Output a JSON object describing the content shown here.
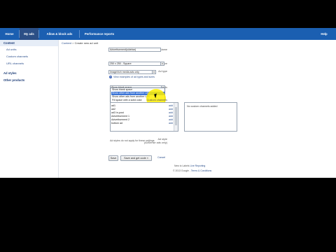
{
  "nav": {
    "items": [
      {
        "label": "Home",
        "active": false
      },
      {
        "label": "My ads",
        "active": true
      },
      {
        "label": "Allow & block ads",
        "active": false
      },
      {
        "label": "Performance reports",
        "active": false
      }
    ],
    "help_label": "Help"
  },
  "sidebar": {
    "content_label": "Content",
    "items": [
      "Ad units",
      "Custom channels",
      "URL channels"
    ],
    "ad_styles_label": "Ad styles",
    "other_products_label": "Other products"
  },
  "breadcrumb": {
    "parent": "Content",
    "separator": ">",
    "current": "Create new ad unit"
  },
  "form": {
    "name_label": "Name",
    "name_value": "Advertisement(sidebar)",
    "ad_size_label": "Ad size",
    "ad_size_value": "250 x 250 - Square",
    "ad_type_label": "Ad type",
    "ad_type_value": "Image/rich media ads only",
    "examples_link": "View examples of ad types and sizes",
    "backup_label": "Backup ads",
    "backup_options": [
      "Show blank space",
      "Show other ads from another URL",
      "Show other ads from another URL",
      "Fill space with a solid color"
    ],
    "custom_channels_label": "Custom channels",
    "channels": [
      {
        "name": "ad1",
        "add": "add"
      },
      {
        "name": "ad2",
        "add": "add"
      },
      {
        "name": "ad3 in-post",
        "add": "add"
      },
      {
        "name": "Advertisement 1",
        "add": "add"
      },
      {
        "name": "Advertisement 2",
        "add": "add"
      },
      {
        "name": "bottom ad",
        "add": "add"
      }
    ],
    "no_channels_text": "No custom channels added",
    "ad_style_label": "Ad style",
    "ad_style_sublabel": "(AdSense ads only)",
    "ad_style_note": "Ad styles do not apply for these settings"
  },
  "buttons": {
    "save": "Save",
    "save_get_code": "Save and get code »",
    "cancel": "Cancel"
  },
  "footer": {
    "line1_prefix": "New to Labels",
    "line1_link": "Live Reporting",
    "line2_prefix": "© 2013 Google",
    "line2_link": "Terms & Conditions"
  }
}
